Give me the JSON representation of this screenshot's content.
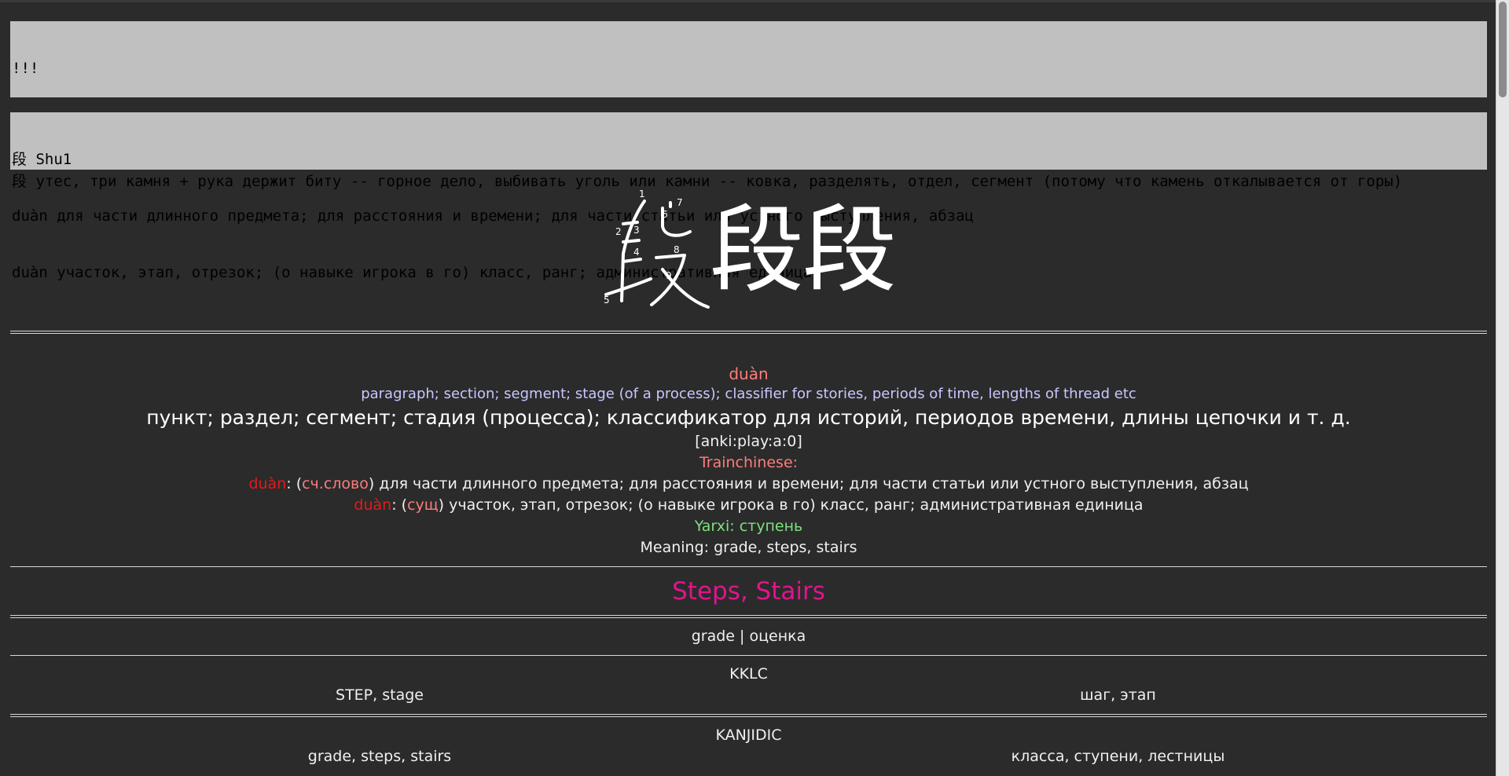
{
  "notes": {
    "note1_line1": "!!!",
    "note1_line2": "段 утес, три камня + рука держит биту -- горное дело, выбивать уголь или камни -- ковка, разделять, отдел, сегмент (потому что камень откалывается от горы)",
    "note2_line1": "段 Shu1",
    "note2_line2": "duàn для части длинного предмета; для расстояния и времени; для части статьи или устного выступления, абзац",
    "note2_line3": "duàn участок, этап, отрезок; (о навыке игрока в го) класс, ранг; административная единица"
  },
  "character": {
    "glyph": "段",
    "stroke_numbers": [
      "1",
      "2",
      "3",
      "4",
      "5",
      "6",
      "7",
      "8",
      "9"
    ]
  },
  "definition": {
    "pinyin": "duàn",
    "english": "paragraph; section; segment; stage (of a process); classifier for stories, periods of time, lengths of thread etc",
    "russian": "пункт; раздел; сегмент; стадия (процесса); классификатор для историй, периодов времени, длины цепочки и т. д.",
    "audio_tag": "[anki:play:a:0]",
    "trainchinese_title": "Trainchinese:",
    "tc1_pinyin": "duàn",
    "tc1_sep1": ": (",
    "tc1_pos": "сч.слово",
    "tc1_text": ") для части длинного предмета; для расстояния и времени; для части статьи или устного выступления, абзац",
    "tc2_pinyin": "duàn",
    "tc2_sep1": ": (",
    "tc2_pos": "сущ",
    "tc2_text": ") участок, этап, отрезок; (о навыке игрока в го) класс, ранг; административная единица",
    "yarxi": "Yarxi: ступень",
    "meaning": "Meaning: grade, steps, stairs"
  },
  "section_title": "Steps, Stairs",
  "grade_line": "grade | оценка",
  "kklc": {
    "title": "KKLC",
    "left": "STEP, stage",
    "right": "шаг, этап"
  },
  "kanjidic": {
    "title": "KANJIDIC",
    "left": "grade, steps, stairs",
    "right": "класса, ступени, лестницы"
  },
  "colors": {
    "background": "#2b2b2b",
    "note_bg": "#c0c0c0",
    "pinyin": "#ff7c7c",
    "english": "#c7c7ff",
    "tone_red": "#e41a1a",
    "yarxi_green": "#7ee07e",
    "section_magenta": "#e0158c"
  }
}
